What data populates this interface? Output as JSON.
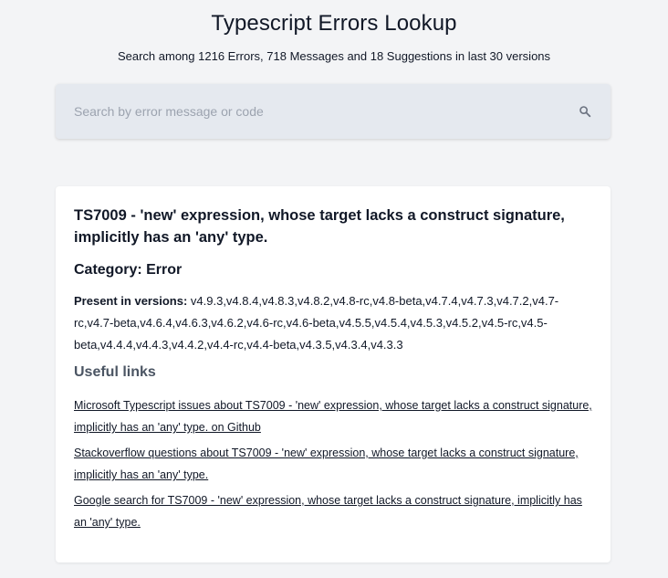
{
  "header": {
    "title": "Typescript Errors Lookup",
    "subtitle": "Search among 1216 Errors, 718 Messages and 18 Suggestions in last 30 versions"
  },
  "search": {
    "placeholder": "Search by error message or code",
    "value": "",
    "icon": "search-icon"
  },
  "result": {
    "heading": "TS7009 - 'new' expression, whose target lacks a construct signature, implicitly has an 'any' type.",
    "category": "Category: Error",
    "versions_label": "Present in versions:",
    "versions_value": "v4.9.3,v4.8.4,v4.8.3,v4.8.2,v4.8-rc,v4.8-beta,v4.7.4,v4.7.3,v4.7.2,v4.7-rc,v4.7-beta,v4.6.4,v4.6.3,v4.6.2,v4.6-rc,v4.6-beta,v4.5.5,v4.5.4,v4.5.3,v4.5.2,v4.5-rc,v4.5-beta,v4.4.4,v4.4.3,v4.4.2,v4.4-rc,v4.4-beta,v4.3.5,v4.3.4,v4.3.3",
    "useful_links_heading": "Useful links",
    "links": [
      "Microsoft Typescript issues about TS7009 - 'new' expression, whose target lacks a construct signature, implicitly has an 'any' type. on Github",
      "Stackoverflow questions about TS7009 - 'new' expression, whose target lacks a construct signature, implicitly has an 'any' type.",
      "Google search for TS7009 - 'new' expression, whose target lacks a construct signature, implicitly has an 'any' type."
    ]
  }
}
